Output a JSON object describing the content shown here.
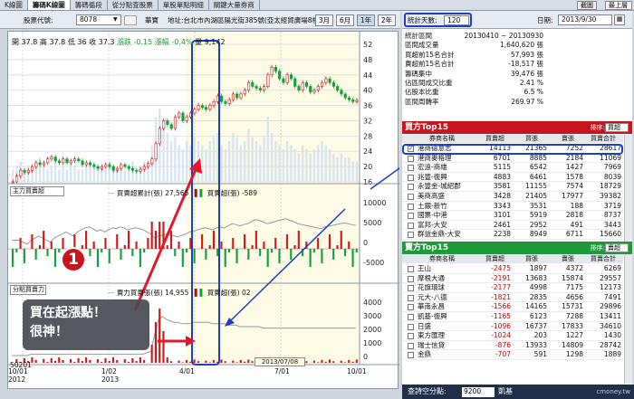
{
  "tabs": [
    "K線圖",
    "籌碼K線圖",
    "籌碼循段",
    "從分點查股票",
    "單股單點明細",
    "關鍵大量券商"
  ],
  "top_buttons": {
    "info": "截圖",
    "top": "最上層"
  },
  "controls": {
    "stock_label": "股票代號:",
    "stock_code": "8078",
    "stock_name": "華寶",
    "address": "地址:台北市內湖區陽光街385號(亞太經貿廣場8樓",
    "periods": [
      "3月",
      "6月",
      "1年",
      "2年"
    ],
    "selected_period": "1年",
    "stat_days_label": "統計天數:",
    "stat_days": "120",
    "date_label": "日期:",
    "date": "2013/9/30"
  },
  "chart": {
    "ohlc_info": {
      "open": "開 37.8",
      "high": "高 37.8",
      "low": "低 36",
      "close": "收 37.3",
      "change": "漲跌 -0.15",
      "pct": "漲幅 -0.4%",
      "vol": "量 9,142"
    },
    "y_price": [
      "52",
      "48",
      "44",
      "40",
      "36",
      "32",
      "28",
      "24",
      "20",
      "16"
    ],
    "panel2": {
      "select": "主力買賣超",
      "legend_line": "買賣超累計(張) 27,565",
      "legend_bar": "買賣超(張) -589",
      "y": [
        "10000",
        "5000",
        "0",
        "-5000"
      ]
    },
    "panel3": {
      "select": "分點買賣力",
      "legend_line": "賣力買賣張(張) 14,955",
      "legend_bar": "買賣超(張) 02",
      "y": [
        "4000",
        "3000",
        "2000",
        "1000",
        "0"
      ]
    },
    "x_ticks": [
      {
        "label": "10/01",
        "sub": "2012"
      },
      {
        "label": "1/02",
        "sub": "2013"
      },
      {
        "label": "4/01",
        "sub": ""
      },
      {
        "label": "7/01",
        "sub": ""
      },
      {
        "label": "10/01",
        "sub": ""
      }
    ],
    "date_box": "2013/07/08",
    "left_top": "50201",
    "badge": "1",
    "annotation_line1": "買在起漲點！",
    "annotation_line2": "很神！",
    "highlight_color": "#1a3fc4",
    "arrow_color": "#e0192b",
    "price_series": [
      16,
      17.5,
      19,
      18.5,
      19,
      20,
      21,
      20.5,
      21,
      22,
      22.5,
      21.5,
      21,
      22,
      21,
      21.5,
      22,
      21.5,
      20.5,
      21,
      20.5,
      20,
      19.5,
      20,
      20.5,
      20,
      19,
      19.5,
      20.5,
      20,
      19.5,
      19,
      18.8,
      19.3,
      20,
      20.8,
      22,
      26,
      30,
      32,
      31,
      30,
      33,
      34,
      32,
      33,
      34,
      35,
      36,
      35.5,
      35,
      36,
      37,
      38.5,
      37,
      36.5,
      37.5,
      39,
      38,
      39,
      40,
      42,
      41,
      40.5,
      40,
      41,
      44,
      46,
      45,
      43,
      42,
      44,
      43,
      41,
      40,
      42,
      41,
      39.5,
      40,
      41,
      42,
      43,
      42,
      41,
      40,
      39,
      38,
      37.5,
      37,
      37.3
    ],
    "volume_series": [
      3,
      4,
      5,
      3,
      4,
      3,
      5,
      6,
      4,
      3,
      4,
      5,
      3,
      4,
      3,
      5,
      4,
      3,
      3,
      4,
      5,
      4,
      3,
      4,
      3,
      5,
      4,
      3,
      4,
      3,
      4,
      5,
      3,
      4,
      5,
      4,
      9,
      16,
      18,
      14,
      12,
      10,
      11,
      9,
      8,
      10,
      9,
      11,
      10,
      9,
      8,
      10,
      11,
      12,
      9,
      8,
      10,
      12,
      11,
      9,
      10,
      13,
      11,
      10,
      9,
      11,
      16,
      12,
      10,
      9,
      8,
      10,
      9,
      8,
      7,
      9,
      8,
      7,
      8,
      9,
      10,
      9,
      8,
      7,
      6,
      7,
      6,
      6,
      5,
      5
    ],
    "accum_series": [
      100,
      100,
      100,
      105,
      110,
      100,
      95,
      90,
      95,
      100,
      105,
      95,
      90,
      85,
      80,
      85,
      90,
      80,
      75,
      70,
      68,
      72,
      78,
      75,
      80,
      75,
      70,
      72,
      68,
      70,
      75,
      72,
      70,
      72,
      75,
      80,
      85,
      95,
      90,
      88,
      85,
      88,
      90,
      92,
      88,
      85,
      80,
      78,
      75,
      72,
      70,
      72,
      75,
      70,
      68,
      70,
      65,
      60,
      62,
      65,
      62,
      60,
      55,
      50,
      52,
      55,
      60,
      58,
      55,
      52,
      50,
      48,
      52,
      55,
      60,
      62,
      64,
      66,
      68,
      70,
      72,
      68,
      66,
      64,
      62,
      60,
      58,
      60,
      62,
      64
    ],
    "panel3_series": [
      5,
      5,
      5,
      5,
      5,
      6,
      6,
      6,
      6,
      6,
      6,
      6,
      6,
      6,
      6,
      6,
      6,
      6,
      6,
      6,
      6,
      6,
      6,
      6,
      6,
      6,
      6,
      6,
      6,
      6,
      6,
      6,
      6,
      6,
      6,
      7,
      8,
      20,
      30,
      32,
      30,
      29,
      28,
      28,
      27,
      27,
      27,
      28,
      28,
      28,
      28,
      28,
      27,
      27,
      27,
      27,
      26,
      26,
      26,
      25,
      25,
      25,
      25,
      25,
      25,
      24,
      24,
      24,
      24,
      24,
      24,
      24,
      24,
      24,
      24,
      24,
      24,
      24,
      24,
      24,
      24,
      24,
      24,
      24,
      24,
      24,
      24,
      24,
      24,
      24
    ]
  },
  "stats": {
    "rows": [
      [
        "統計區間",
        "20130410 ~ 20130930"
      ],
      [
        "區間成交量",
        "1,640,620 張"
      ],
      [
        "買超前15名合計",
        "57,993 張"
      ],
      [
        "賣超前15名合計",
        "-18,517 張"
      ],
      [
        "籌碼集中",
        "39,476 張"
      ],
      [
        "佔區間成交比重",
        "2.41 %"
      ],
      [
        "佔股本比重",
        "6.5 %"
      ],
      [
        "區間周轉率",
        "269.97 %"
      ]
    ]
  },
  "buy_top": {
    "title": "買方Top15",
    "sort_label": "排序:",
    "sort_value": "買超",
    "color": "#c8141c",
    "columns": [
      "券商名稱",
      "買賣超",
      "買張",
      "賣張",
      "買賣合計"
    ],
    "rows": [
      [
        "港商德意志",
        "14113",
        "21365",
        "7252",
        "28617"
      ],
      [
        "港商麥格理",
        "6701",
        "8885",
        "2184",
        "11069"
      ],
      [
        "宏遠-商雄",
        "5115",
        "6542",
        "1427",
        "7969"
      ],
      [
        "兆豐-復興",
        "4883",
        "6461",
        "1578",
        "8039"
      ],
      [
        "永豐金-城紹郡",
        "3581",
        "11155",
        "7574",
        "18729"
      ],
      [
        "美商高盛",
        "3428",
        "21405",
        "17977",
        "39382"
      ],
      [
        "土銀-新竹",
        "3343",
        "3531",
        "188",
        "3719"
      ],
      [
        "國票-中港",
        "3101",
        "5919",
        "2818",
        "8737"
      ],
      [
        "富邦-大安",
        "2461",
        "2952",
        "491",
        "3443"
      ],
      [
        "群益金鼎-大安",
        "2238",
        "8949",
        "6711",
        "15660"
      ]
    ]
  },
  "sell_top": {
    "title": "賣方Top15",
    "sort_label": "排序:",
    "sort_value": "賣超",
    "color": "#1e9a3a",
    "columns": [
      "券商名稱",
      "買賣超",
      "買張",
      "賣張",
      "買賣合計"
    ],
    "rows": [
      [
        "王山",
        "-2475",
        "1897",
        "4372",
        "6269"
      ],
      [
        "摩根大通",
        "-2191",
        "13683",
        "15874",
        "29557"
      ],
      [
        "花旗環球",
        "-2177",
        "4998",
        "7175",
        "12173"
      ],
      [
        "元大-八德",
        "-1821",
        "2835",
        "4656",
        "7491"
      ],
      [
        "華南永昌",
        "-1566",
        "14165",
        "15731",
        "29896"
      ],
      [
        "凱基-復興",
        "-1165",
        "6123",
        "7288",
        "13411"
      ],
      [
        "日盛",
        "-1096",
        "16737",
        "17833",
        "34610"
      ],
      [
        "東方匯理",
        "-1024",
        "203",
        "1227",
        "1430"
      ],
      [
        "瑞士信貸",
        "-876",
        "13933",
        "14809",
        "28742"
      ],
      [
        "金鼎",
        "-707",
        "591",
        "1298",
        "1889"
      ]
    ]
  },
  "bottom": {
    "label": "查詩空分點:",
    "value": "9200",
    "name": "凱基",
    "watermark": "cmoney.tw"
  }
}
